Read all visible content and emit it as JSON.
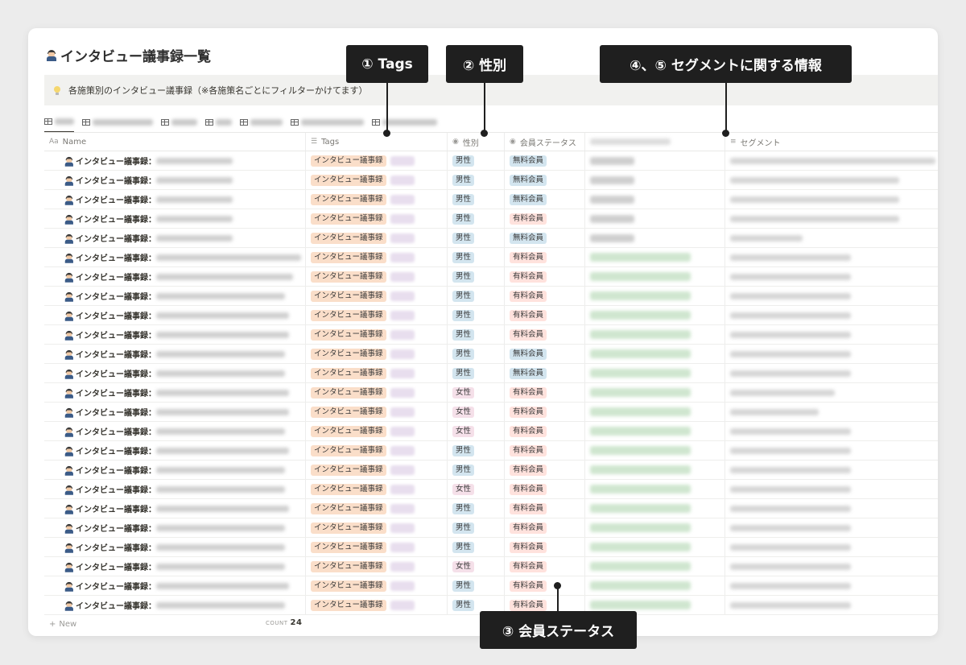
{
  "page": {
    "title": "インタビュー議事録一覧"
  },
  "callout": {
    "text": "各施策別のインタビュー議事録（※各施策名ごとにフィルターかけてます）"
  },
  "columns": {
    "name": "Name",
    "tags": "Tags",
    "sex": "性別",
    "status": "会員ステータス",
    "segment": "セグメント"
  },
  "row_label": "インタビュー議事録：",
  "tag_label": "インタビュー議事録",
  "rows": [
    {
      "sex": "男性",
      "status": "無料会員"
    },
    {
      "sex": "男性",
      "status": "無料会員"
    },
    {
      "sex": "男性",
      "status": "無料会員"
    },
    {
      "sex": "男性",
      "status": "有料会員"
    },
    {
      "sex": "男性",
      "status": "無料会員"
    },
    {
      "sex": "男性",
      "status": "有料会員"
    },
    {
      "sex": "男性",
      "status": "有料会員"
    },
    {
      "sex": "男性",
      "status": "有料会員"
    },
    {
      "sex": "男性",
      "status": "有料会員"
    },
    {
      "sex": "男性",
      "status": "有料会員"
    },
    {
      "sex": "男性",
      "status": "無料会員"
    },
    {
      "sex": "男性",
      "status": "無料会員"
    },
    {
      "sex": "女性",
      "status": "有料会員"
    },
    {
      "sex": "女性",
      "status": "有料会員"
    },
    {
      "sex": "女性",
      "status": "有料会員"
    },
    {
      "sex": "男性",
      "status": "有料会員"
    },
    {
      "sex": "男性",
      "status": "有料会員"
    },
    {
      "sex": "女性",
      "status": "有料会員"
    },
    {
      "sex": "男性",
      "status": "有料会員"
    },
    {
      "sex": "男性",
      "status": "有料会員"
    },
    {
      "sex": "男性",
      "status": "有料会員"
    },
    {
      "sex": "女性",
      "status": "有料会員"
    },
    {
      "sex": "男性",
      "status": "有料会員"
    },
    {
      "sex": "男性",
      "status": "有料会員"
    }
  ],
  "new_row_label": "New",
  "footer": {
    "count_label": "COUNT",
    "count_value": "24"
  },
  "annotations": {
    "tags": "① Tags",
    "sex": "② 性別",
    "status": "③ 会員ステータス",
    "segment": "④、⑤ セグメントに関する情報"
  },
  "colors": {
    "tag_orange": "#fadec9",
    "male_blue": "#d3e5ef",
    "female_pink": "#f5e0e9",
    "paid_red": "#ffe2dd",
    "free_blue": "#d3e5ef",
    "annotation_bg": "#1f1f1f"
  }
}
